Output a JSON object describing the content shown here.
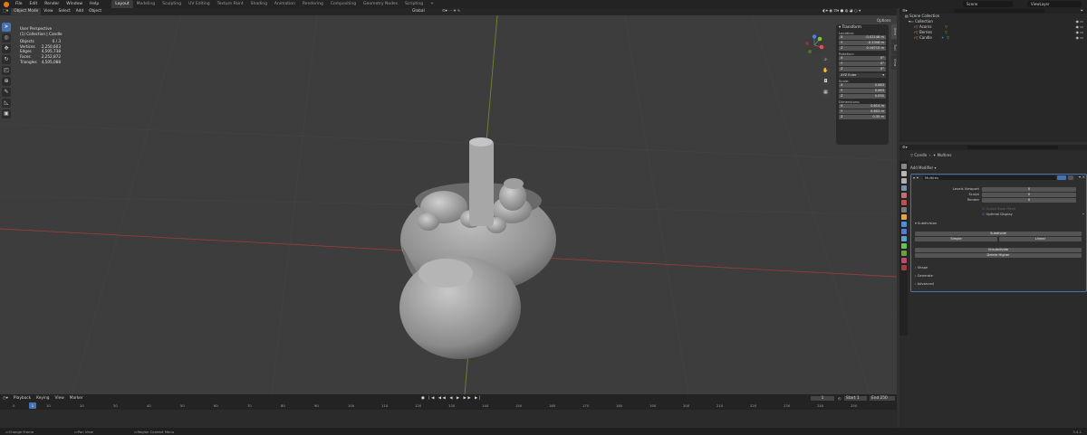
{
  "menu": [
    "File",
    "Edit",
    "Render",
    "Window",
    "Help"
  ],
  "workspaces": [
    "Layout",
    "Modeling",
    "Sculpting",
    "UV Editing",
    "Texture Paint",
    "Shading",
    "Animation",
    "Rendering",
    "Compositing",
    "Geometry Nodes",
    "Scripting"
  ],
  "scene": "Scene",
  "view_layer": "ViewLayer",
  "header": {
    "mode": "Object Mode",
    "view": "View",
    "select": "Select",
    "add": "Add",
    "object": "Object",
    "orientation": "Global",
    "options": "Options"
  },
  "stats": {
    "perspective": "User Perspective",
    "collection": "(1) Collection | Candle",
    "rows": [
      {
        "label": "Objects",
        "value": "0 / 3"
      },
      {
        "label": "Vertices",
        "value": "2,250,603"
      },
      {
        "label": "Edges",
        "value": "4,505,738"
      },
      {
        "label": "Faces",
        "value": "2,252,872"
      },
      {
        "label": "Triangles",
        "value": "4,505,088"
      }
    ]
  },
  "transform": {
    "title": "Transform",
    "location_label": "Location:",
    "location": [
      {
        "axis": "X",
        "value": "-0.02146 m"
      },
      {
        "axis": "Y",
        "value": "-0.2308 m"
      },
      {
        "axis": "Z",
        "value": "0.16715 m"
      }
    ],
    "rotation_label": "Rotation:",
    "rotation": [
      {
        "axis": "X",
        "value": "0°"
      },
      {
        "axis": "Y",
        "value": "0°"
      },
      {
        "axis": "Z",
        "value": "0°"
      }
    ],
    "rotation_mode": "XYZ Euler",
    "scale_label": "Scale:",
    "scale": [
      {
        "axis": "X",
        "value": "0.063"
      },
      {
        "axis": "Y",
        "value": "0.063"
      },
      {
        "axis": "Z",
        "value": "0.035"
      }
    ],
    "dimensions_label": "Dimensions:",
    "dimensions": [
      {
        "axis": "X",
        "value": "0.614 m"
      },
      {
        "axis": "Y",
        "value": "0.602 m"
      },
      {
        "axis": "Z",
        "value": "0.35 m"
      }
    ]
  },
  "sidebar_tabs": [
    "Item",
    "Tool",
    "View"
  ],
  "outliner": {
    "root": "Scene Collection",
    "collection": "Collection",
    "items": [
      "Acorns",
      "Berries",
      "Candle"
    ]
  },
  "properties": {
    "breadcrumb_object": "Candle",
    "breadcrumb_modifier": "Multires",
    "add_modifier": "Add Modifier",
    "modifier_name": "Multires",
    "fields": [
      {
        "label": "Levels Viewport",
        "value": "0"
      },
      {
        "label": "Sculpt",
        "value": "0"
      },
      {
        "label": "Render",
        "value": "0"
      }
    ],
    "sculpt_base_mesh": "Sculpt Base Mesh",
    "optimal_display": "Optimal Display",
    "subdivision_label": "Subdivision",
    "subdivide": "Subdivide",
    "simple": "Simple",
    "linear": "Linear",
    "unsubdivide": "Unsubdivide",
    "delete_higher": "Delete Higher",
    "sections": [
      "Shape",
      "Generate",
      "Advanced"
    ]
  },
  "timeline": {
    "menus": [
      "Playback",
      "Keying",
      "View",
      "Marker"
    ],
    "current_frame": "1",
    "start_label": "Start",
    "start": "1",
    "end_label": "End",
    "end": "250",
    "ticks": [
      "0",
      "10",
      "20",
      "30",
      "40",
      "50",
      "60",
      "70",
      "80",
      "90",
      "100",
      "110",
      "120",
      "130",
      "140",
      "150",
      "160",
      "170",
      "180",
      "190",
      "200",
      "210",
      "220",
      "230",
      "240",
      "250"
    ]
  },
  "status": {
    "left": "Change Frame",
    "middle": "Pan View",
    "right": "Region Context Menu",
    "version": "3.4.1"
  }
}
